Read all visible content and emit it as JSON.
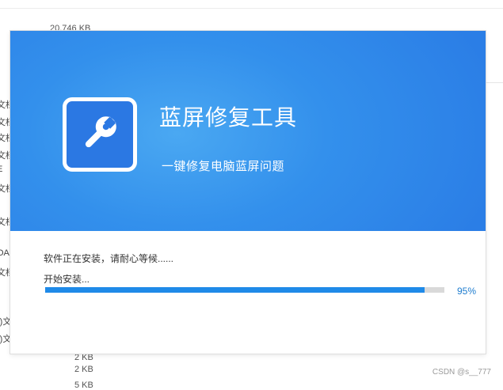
{
  "background": {
    "top_size": "20,746 KB",
    "left_fragments": [
      "文档",
      "文档",
      "文档",
      "文档",
      "E",
      "文档",
      "文档",
      "OA",
      "文档",
      "()文",
      "()文"
    ],
    "bottom_sizes": [
      "2 KB",
      "2 KB",
      "5 KB"
    ]
  },
  "installer": {
    "app_name": "蓝屏修复工具",
    "tagline": "一键修复电脑蓝屏问题",
    "logo_icon": "wrench-icon",
    "status_message": "软件正在安装，请耐心等候......",
    "step_label": "开始安装...",
    "progress": {
      "value": 0.95,
      "label": "95%"
    },
    "colors": {
      "banner": "#2b7ee6",
      "progress_fill": "#1f8ae8",
      "progress_track": "#d9d9d9",
      "percent_text": "#1f7dcf"
    }
  },
  "watermark": "CSDN @s__777"
}
